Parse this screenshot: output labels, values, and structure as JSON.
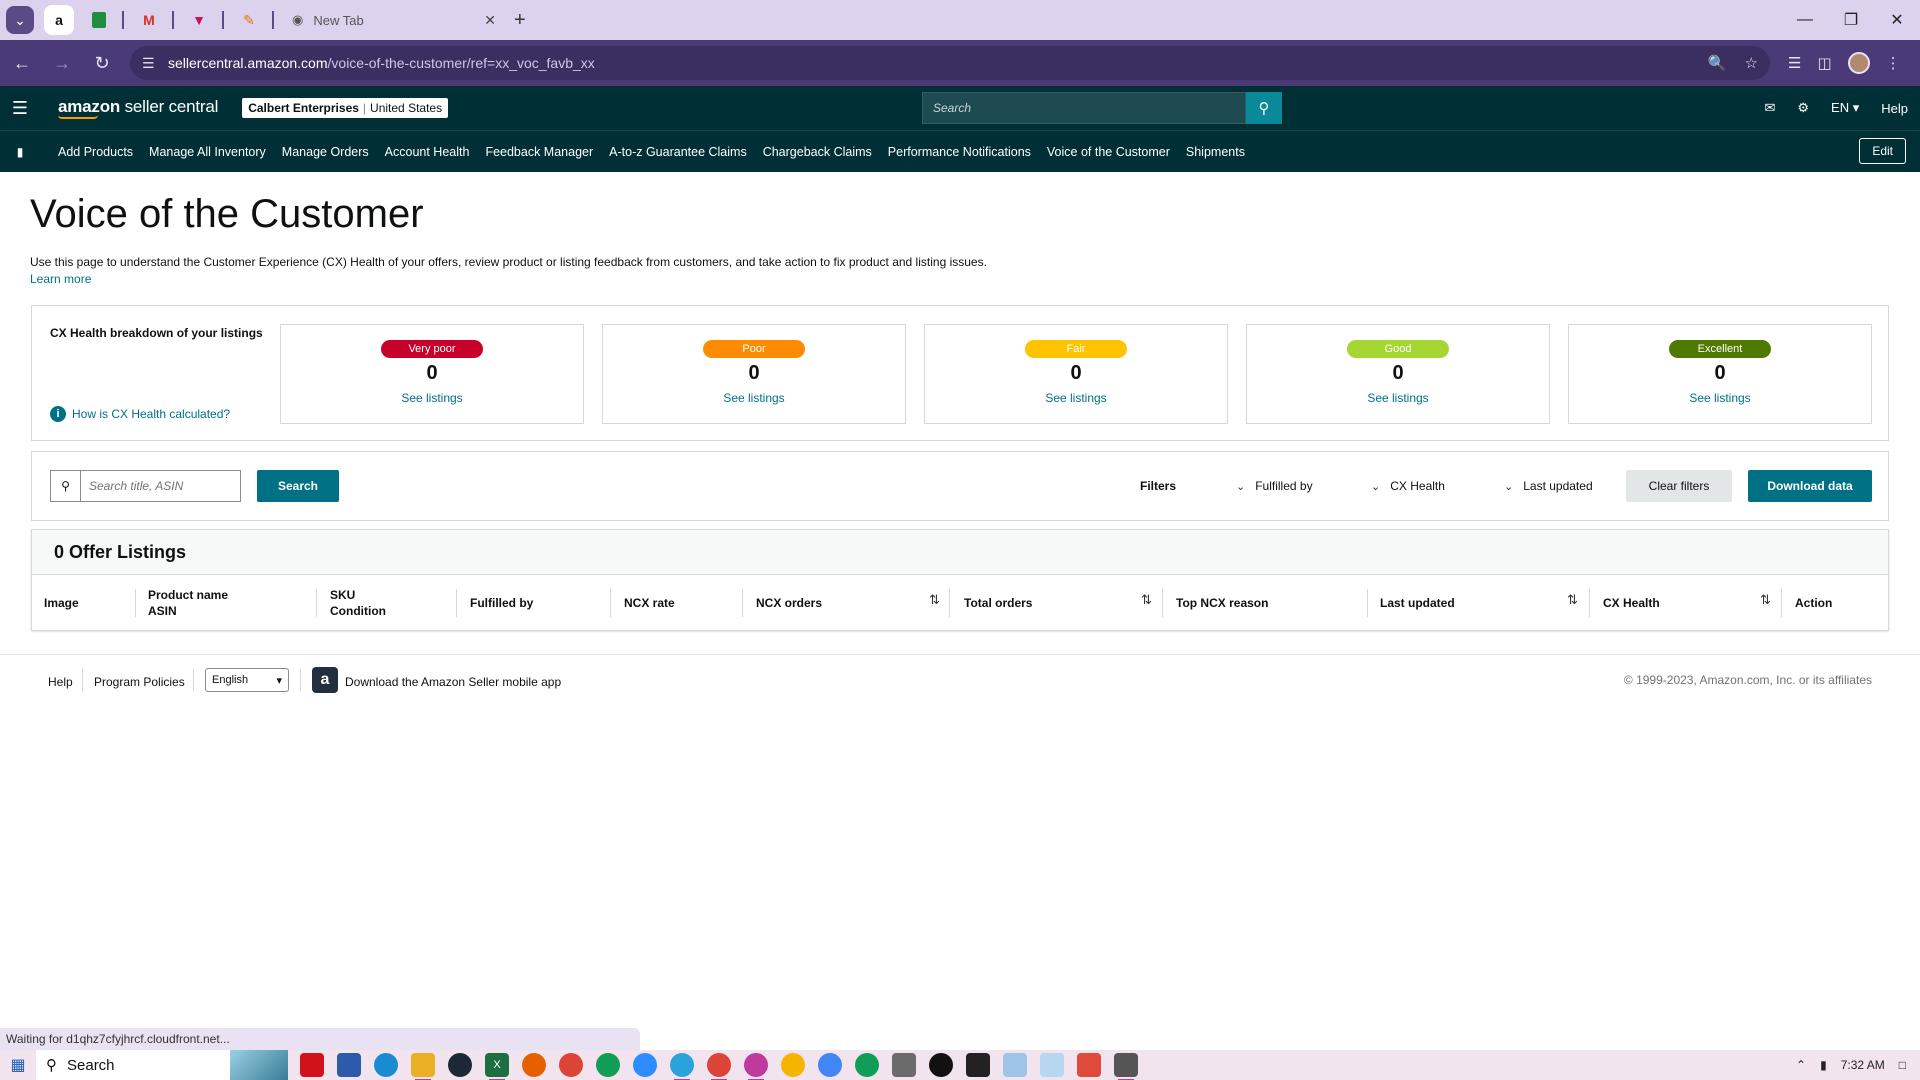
{
  "browser": {
    "tab_title": "New Tab",
    "url_host": "sellercentral.amazon.com",
    "url_path": "/voice-of-the-customer/ref=xx_voc_favb_xx",
    "status_text": "Waiting for d1qhz7cfyjhrcf.cloudfront.net..."
  },
  "header": {
    "logo_bold": "amazon",
    "logo_rest": " seller central",
    "account_name": "Calbert Enterprises",
    "account_region": "United States",
    "search_placeholder": "Search",
    "lang": "EN",
    "help": "Help"
  },
  "nav": {
    "links": [
      "Add Products",
      "Manage All Inventory",
      "Manage Orders",
      "Account Health",
      "Feedback Manager",
      "A-to-z Guarantee Claims",
      "Chargeback Claims",
      "Performance Notifications",
      "Voice of the Customer",
      "Shipments"
    ],
    "edit": "Edit"
  },
  "page": {
    "title": "Voice of the Customer",
    "description": "Use this page to understand the Customer Experience (CX) Health of your offers, review product or listing feedback from customers, and take action to fix product and listing issues.",
    "learn_more": "Learn more"
  },
  "cx": {
    "label": "CX Health breakdown of your listings",
    "how": "How is CX Health calculated?",
    "cards": [
      {
        "badge": "Very poor",
        "count": "0",
        "link": "See listings",
        "bg": "#c7002c",
        "fg": "#ffffff"
      },
      {
        "badge": "Poor",
        "count": "0",
        "link": "See listings",
        "bg": "#ff8c00",
        "fg": "#ffffff"
      },
      {
        "badge": "Fair",
        "count": "0",
        "link": "See listings",
        "bg": "#ffc300",
        "fg": "#ffffff"
      },
      {
        "badge": "Good",
        "count": "0",
        "link": "See listings",
        "bg": "#a6d631",
        "fg": "#ffffff"
      },
      {
        "badge": "Excellent",
        "count": "0",
        "link": "See listings",
        "bg": "#4f7a00",
        "fg": "#ffffff"
      }
    ]
  },
  "filters": {
    "search_placeholder": "Search title, ASIN",
    "search_button": "Search",
    "label": "Filters",
    "dropdowns": [
      "Fulfilled by",
      "CX Health",
      "Last updated"
    ],
    "clear": "Clear filters",
    "download": "Download data"
  },
  "listings": {
    "heading": "0 Offer Listings",
    "columns": {
      "image": "Image",
      "product_name": "Product name",
      "asin": "ASIN",
      "sku": "SKU",
      "condition": "Condition",
      "fulfilled_by": "Fulfilled by",
      "ncx_rate": "NCX rate",
      "ncx_orders": "NCX orders",
      "total_orders": "Total orders",
      "top_ncx_reason": "Top NCX reason",
      "last_updated": "Last updated",
      "cx_health": "CX Health",
      "action": "Action"
    }
  },
  "footer": {
    "help": "Help",
    "policies": "Program Policies",
    "language": "English",
    "app": "Download the Amazon Seller mobile app",
    "copyright": "© 1999-2023, Amazon.com, Inc. or its affiliates"
  },
  "taskbar": {
    "search": "Search",
    "time": "7:32 AM"
  }
}
